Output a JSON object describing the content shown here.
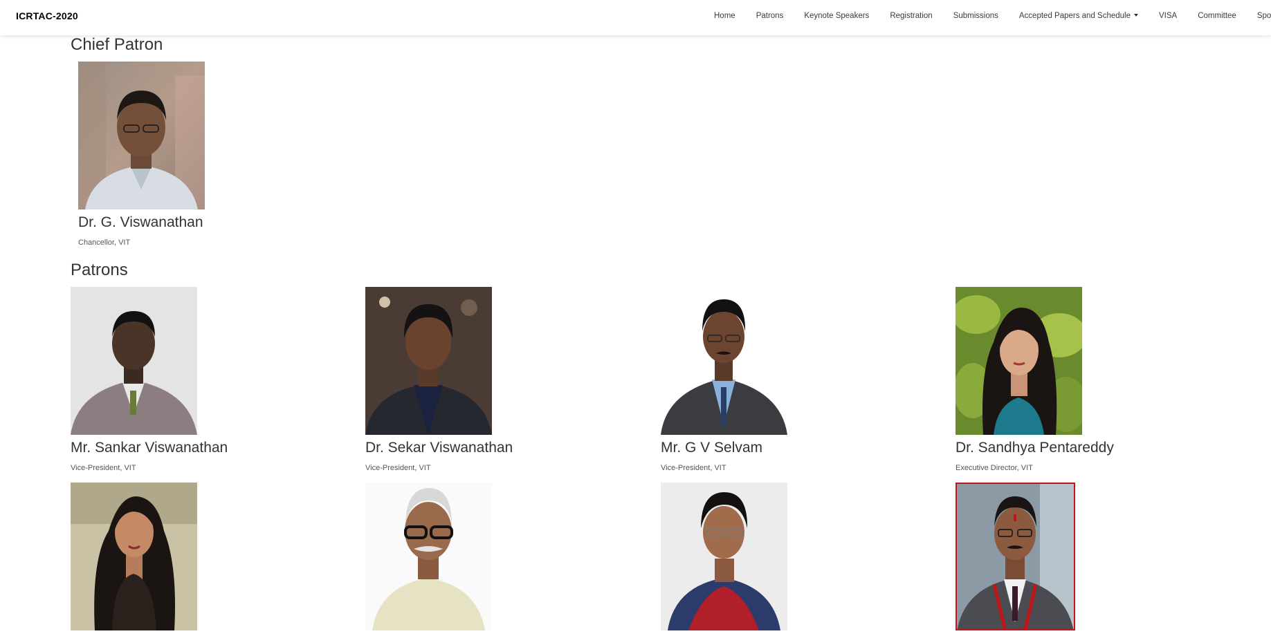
{
  "navbar": {
    "brand": "ICRTAC-2020",
    "links": [
      "Home",
      "Patrons",
      "Keynote Speakers",
      "Registration",
      "Submissions",
      "Accepted Papers and Schedule",
      "VISA",
      "Committee",
      "Sponsors"
    ]
  },
  "chief_patron": {
    "title": "Chief Patron",
    "person": {
      "name": "Dr. G. Viswanathan",
      "role": "Chancellor, VIT"
    }
  },
  "patrons": {
    "title": "Patrons",
    "people": [
      {
        "name": "Mr. Sankar Viswanathan",
        "role": "Vice-President, VIT"
      },
      {
        "name": "Dr. Sekar Viswanathan",
        "role": "Vice-President, VIT"
      },
      {
        "name": "Mr. G V Selvam",
        "role": "Vice-President, VIT"
      },
      {
        "name": "Dr. Sandhya Pentareddy",
        "role": "Executive Director, VIT"
      },
      {
        "name": "",
        "role": ""
      },
      {
        "name": "",
        "role": ""
      },
      {
        "name": "",
        "role": ""
      },
      {
        "name": "",
        "role": ""
      }
    ]
  },
  "colors": {
    "text": "#333333",
    "highlight_border": "#c0151a"
  }
}
